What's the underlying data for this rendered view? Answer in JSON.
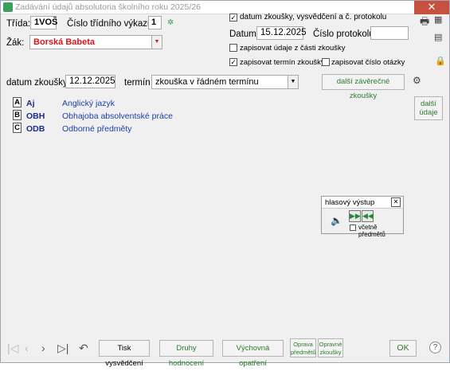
{
  "window": {
    "title": "Zadávání údajů absolutoria školního roku 2025/26",
    "close": "✕"
  },
  "header": {
    "trida_label": "Třída:",
    "trida_value": "1VOŠ",
    "vykaz_label": "Číslo třídního výkazu:",
    "vykaz_value": "1",
    "zak_label": "Žák:",
    "zak_value": "Borská Babeta"
  },
  "right": {
    "chk_datum_label": "datum zkoušky, vysvědčení a č. protokolu",
    "datum_label": "Datum",
    "datum_value": "15.12.2025",
    "protokol_label": "Číslo protokolu",
    "protokol_value": "",
    "chk_cast_label": "zapisovat údaje z části zkoušky",
    "chk_termin_label": "zapisovat termín zkoušky",
    "chk_otazka_label": "zapisovat číslo otázky"
  },
  "exam": {
    "datum_label": "datum zkoušky",
    "datum_value": "12.12.2025",
    "termin_label": "termín",
    "termin_value": "zkouška v řádném termínu",
    "dalsi_zaverecne": "další závěrečné zkoušky",
    "dalsi_udaje_1": "další",
    "dalsi_udaje_2": "údaje"
  },
  "subjects": [
    {
      "letter": "A",
      "code": "Aj",
      "name": "Anglický jazyk"
    },
    {
      "letter": "B",
      "code": "OBH",
      "name": "Obhajoba absolventské práce"
    },
    {
      "letter": "C",
      "code": "ODB",
      "name": "Odborné předměty"
    }
  ],
  "voice": {
    "title": "hlasový výstup",
    "close": "✕",
    "chk_label": "včetně předmětů"
  },
  "footer": {
    "tisk": "Tisk vysvědčení",
    "druhy": "Druhy hodnocení",
    "vychovna": "Výchovná opatření",
    "oprava_1": "Oprava",
    "oprava_2": "předmětů",
    "opravne_1": "Opravné",
    "opravne_2": "zkoušky",
    "ok": "OK",
    "help": "?"
  },
  "colors": {
    "student_name": "#d4181e",
    "green_text": "#2d7a2d",
    "subject_blue": "#1a3fa8"
  }
}
